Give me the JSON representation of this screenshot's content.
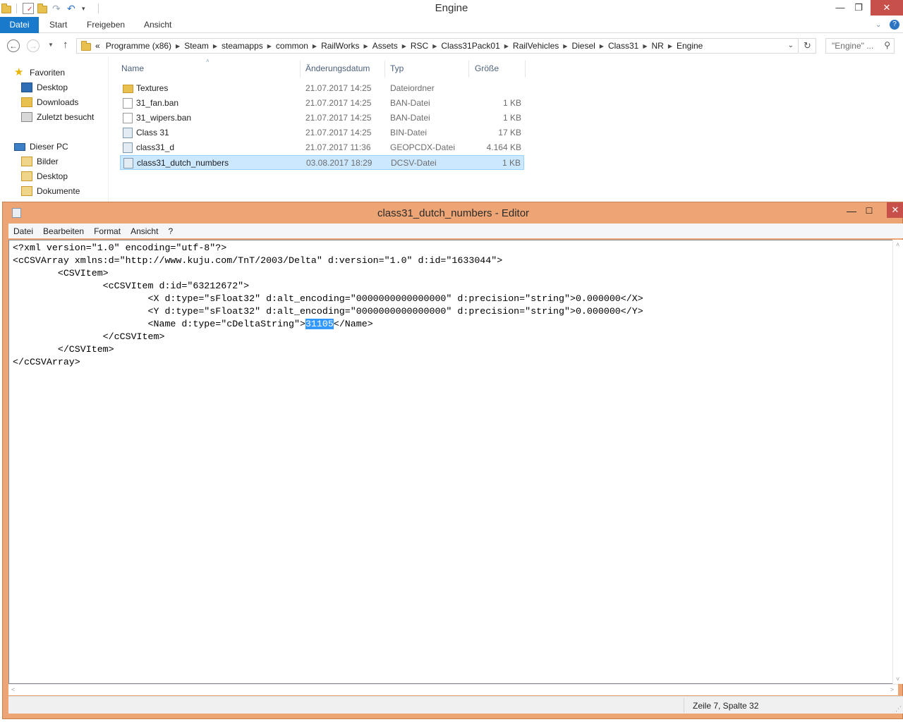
{
  "explorer": {
    "title": "Engine",
    "window_controls": {
      "minimize": "—",
      "maximize": "❐",
      "close": "✕"
    },
    "ribbon_tabs": [
      "Datei",
      "Start",
      "Freigeben",
      "Ansicht"
    ],
    "address": {
      "prefix": "«",
      "crumbs": [
        "Programme (x86)",
        "Steam",
        "steamapps",
        "common",
        "RailWorks",
        "Assets",
        "RSC",
        "Class31Pack01",
        "RailVehicles",
        "Diesel",
        "Class31",
        "NR",
        "Engine"
      ]
    },
    "search_placeholder": "\"Engine\" ...",
    "navpane": {
      "favorites": {
        "label": "Favoriten",
        "items": [
          "Desktop",
          "Downloads",
          "Zuletzt besucht"
        ]
      },
      "pc": {
        "label": "Dieser PC",
        "items": [
          "Bilder",
          "Desktop",
          "Dokumente"
        ]
      }
    },
    "columns": {
      "name": "Name",
      "date": "Änderungsdatum",
      "type": "Typ",
      "size": "Größe"
    },
    "files": [
      {
        "name": "Textures",
        "date": "21.07.2017 14:25",
        "type": "Dateiordner",
        "size": "",
        "icon": "folder-icon"
      },
      {
        "name": "31_fan.ban",
        "date": "21.07.2017 14:25",
        "type": "BAN-Datei",
        "size": "1 KB",
        "icon": "file-icon"
      },
      {
        "name": "31_wipers.ban",
        "date": "21.07.2017 14:25",
        "type": "BAN-Datei",
        "size": "1 KB",
        "icon": "file-icon"
      },
      {
        "name": "Class 31",
        "date": "21.07.2017 14:25",
        "type": "BIN-Datei",
        "size": "17 KB",
        "icon": "binary-file-icon"
      },
      {
        "name": "class31_d",
        "date": "21.07.2017 11:36",
        "type": "GEOPCDX-Datei",
        "size": "4.164 KB",
        "icon": "binary-file-icon"
      },
      {
        "name": "class31_dutch_numbers",
        "date": "03.08.2017 18:29",
        "type": "DCSV-Datei",
        "size": "1 KB",
        "icon": "binary-file-icon",
        "selected": true
      }
    ]
  },
  "notepad": {
    "title": "class31_dutch_numbers - Editor",
    "menu": [
      "Datei",
      "Bearbeiten",
      "Format",
      "Ansicht",
      "?"
    ],
    "lines": [
      "<?xml version=\"1.0\" encoding=\"utf-8\"?>",
      "<cCSVArray xmlns:d=\"http://www.kuju.com/TnT/2003/Delta\" d:version=\"1.0\" d:id=\"1633044\">",
      "        <CSVItem>",
      "                <cCSVItem d:id=\"63212672\">",
      "                        <X d:type=\"sFloat32\" d:alt_encoding=\"0000000000000000\" d:precision=\"string\">0.000000</X>",
      "                        <Y d:type=\"sFloat32\" d:alt_encoding=\"0000000000000000\" d:precision=\"string\">0.000000</Y>",
      "                        <Name d:type=\"cDeltaString\">",
      "                </cCSVItem>",
      "        </CSVItem>",
      "</cCSVArray>"
    ],
    "selected_text": "31105",
    "line7_suffix": "</Name>",
    "status": "Zeile 7, Spalte 32"
  }
}
